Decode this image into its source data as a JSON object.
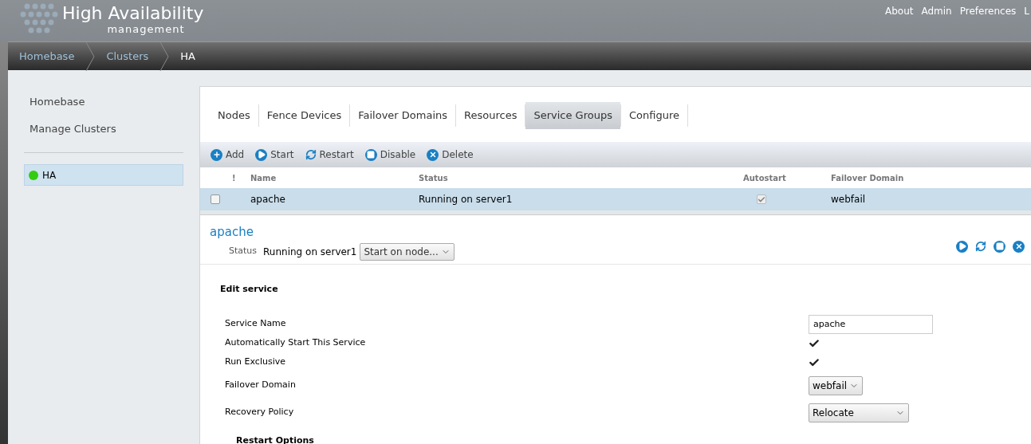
{
  "header": {
    "title": "High Availability",
    "subtitle": "management",
    "links": [
      "About",
      "Admin",
      "Preferences",
      "L"
    ]
  },
  "breadcrumb": [
    {
      "label": "Homebase",
      "selected": false
    },
    {
      "label": "Clusters",
      "selected": false
    },
    {
      "label": "HA",
      "selected": true
    }
  ],
  "sidebar": {
    "links": [
      "Homebase",
      "Manage Clusters"
    ],
    "clusters": [
      {
        "name": "HA",
        "color": "#33cc11",
        "selected": true
      }
    ]
  },
  "tabs": [
    {
      "label": "Nodes",
      "selected": false
    },
    {
      "label": "Fence Devices",
      "selected": false
    },
    {
      "label": "Failover Domains",
      "selected": false
    },
    {
      "label": "Resources",
      "selected": false
    },
    {
      "label": "Service Groups",
      "selected": true
    },
    {
      "label": "Configure",
      "selected": false
    }
  ],
  "toolbar": [
    {
      "kind": "add",
      "label": "Add"
    },
    {
      "kind": "start",
      "label": "Start"
    },
    {
      "kind": "restart",
      "label": "Restart"
    },
    {
      "kind": "stop",
      "label": "Disable"
    },
    {
      "kind": "delete",
      "label": "Delete"
    }
  ],
  "table": {
    "columns": [
      "!",
      "Name",
      "Status",
      "Autostart",
      "Failover Domain"
    ],
    "rows": [
      {
        "checked": false,
        "selected": true,
        "name": "apache",
        "status": "Running on server1",
        "autostart": true,
        "failover_domain": "webfail"
      }
    ]
  },
  "detail": {
    "title": "apache",
    "status_label": "Status",
    "status_value": "Running on server1",
    "node_select": "Start on node...",
    "actions": [
      {
        "kind": "start"
      },
      {
        "kind": "restart"
      },
      {
        "kind": "stop"
      },
      {
        "kind": "delete"
      }
    ]
  },
  "form": {
    "heading": "Edit service",
    "fields": [
      {
        "kind": "text",
        "label": "Service Name",
        "value": "apache"
      },
      {
        "kind": "checkbox",
        "label": "Automatically Start This Service",
        "checked": true
      },
      {
        "kind": "checkbox",
        "label": "Run Exclusive",
        "checked": true
      },
      {
        "kind": "select",
        "label": "Failover Domain",
        "value": "webfail"
      },
      {
        "kind": "select",
        "label": "Recovery Policy",
        "value": "Relocate",
        "wide": true
      }
    ],
    "section": "Restart Options"
  }
}
